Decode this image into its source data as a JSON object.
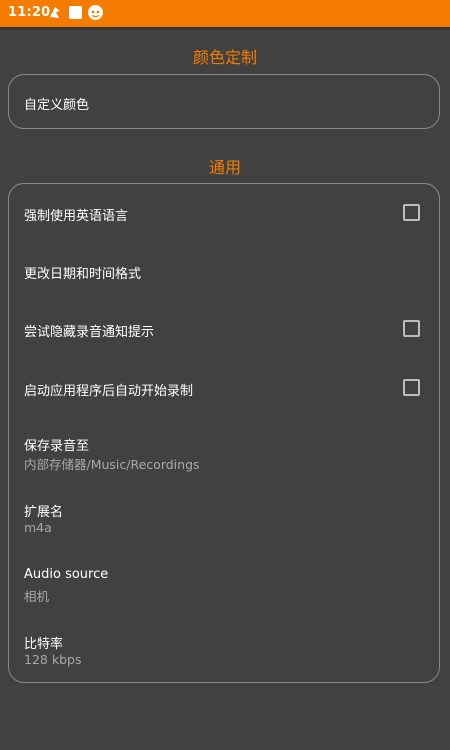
{
  "status_bar": {
    "time": "11:20",
    "icons": [
      "notification-app-icon",
      "square-notification-icon",
      "cat-app-icon"
    ]
  },
  "colors": {
    "accent": "#f57c00",
    "background": "#414141",
    "card_border": "#8a8a8a",
    "text_primary": "#ffffff",
    "text_secondary": "#a8a8a8"
  },
  "sections": [
    {
      "title": "颜色定制",
      "items": [
        {
          "title": "自定义颜色"
        }
      ]
    },
    {
      "title": "通用",
      "items": [
        {
          "title": "强制使用英语语言",
          "checkbox": false
        },
        {
          "title": "更改日期和时间格式"
        },
        {
          "title": "尝试隐藏录音通知提示",
          "checkbox": false
        },
        {
          "title": "启动应用程序后自动开始录制",
          "checkbox": false
        },
        {
          "title": "保存录音至",
          "summary": "内部存储器/Music/Recordings"
        },
        {
          "title": "扩展名",
          "summary": "m4a"
        },
        {
          "title": "Audio source",
          "summary": "相机"
        },
        {
          "title": "比特率",
          "summary": "128 kbps"
        }
      ]
    }
  ]
}
